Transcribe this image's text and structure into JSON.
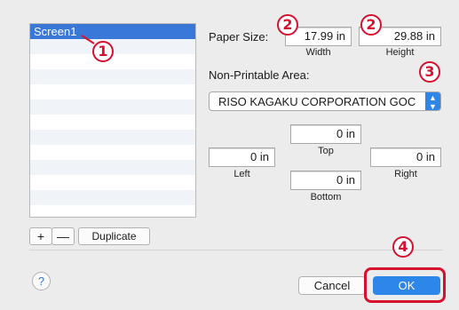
{
  "list": {
    "items": [
      "Screen1"
    ],
    "add_label": "+",
    "remove_label": "—",
    "duplicate_label": "Duplicate"
  },
  "paper_size": {
    "label": "Paper Size:",
    "width_value": "17.99 in",
    "width_caption": "Width",
    "height_value": "29.88 in",
    "height_caption": "Height"
  },
  "non_printable": {
    "label": "Non-Printable Area:",
    "selected": "RISO KAGAKU CORPORATION GOC",
    "top_value": "0 in",
    "top_caption": "Top",
    "left_value": "0 in",
    "left_caption": "Left",
    "right_value": "0 in",
    "right_caption": "Right",
    "bottom_value": "0 in",
    "bottom_caption": "Bottom"
  },
  "buttons": {
    "help": "?",
    "cancel": "Cancel",
    "ok": "OK"
  },
  "callouts": {
    "c1": "1",
    "c2a": "2",
    "c2b": "2",
    "c3": "3",
    "c4": "4"
  },
  "colors": {
    "accent": "#2d86ea",
    "selection": "#3a78d8",
    "callout_red": "#d6102e"
  },
  "icons": {
    "popup_arrows": "updown-chevron-icon",
    "help": "question-mark-icon"
  }
}
